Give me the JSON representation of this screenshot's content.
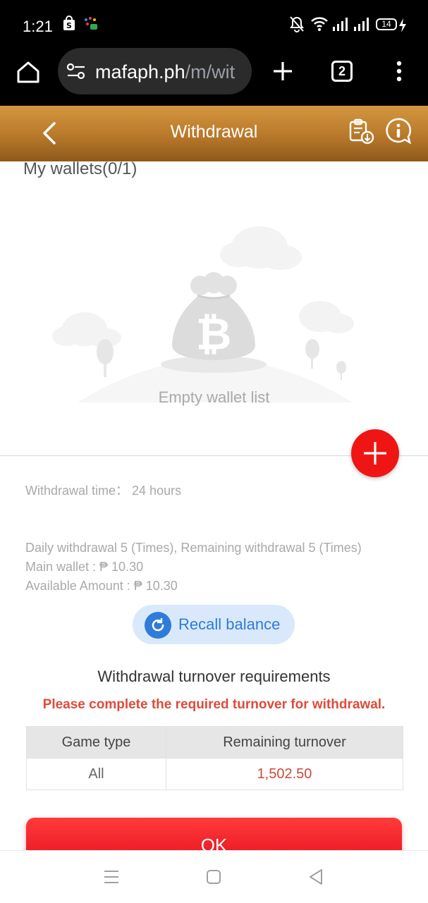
{
  "status_bar": {
    "time": "1:21",
    "battery": "14"
  },
  "browser": {
    "url_host": "mafaph.ph",
    "url_path": "/m/wit",
    "tab_count": "2"
  },
  "header": {
    "title": "Withdrawal"
  },
  "wallets": {
    "title": "My wallets(0/1)",
    "empty_text": "Empty wallet list"
  },
  "info": {
    "withdrawal_time": "Withdrawal time： 24 hours",
    "daily_limit": "Daily withdrawal 5 (Times), Remaining withdrawal 5 (Times)",
    "main_wallet": "Main wallet : ₱ 10.30",
    "available_amount": "Available Amount : ₱ 10.30"
  },
  "recall_button": {
    "label": "Recall balance"
  },
  "turnover": {
    "title": "Withdrawal turnover requirements",
    "warning": "Please complete the required turnover for withdrawal.",
    "table": {
      "headers": [
        "Game type",
        "Remaining turnover"
      ],
      "rows": [
        {
          "game_type": "All",
          "remaining": "1,502.50"
        }
      ]
    }
  },
  "ok_button": {
    "label": "OK"
  },
  "colors": {
    "header_gold": "#c4873a",
    "accent_red": "#f01515",
    "warning_red": "#e04a3a",
    "recall_blue": "#2f7bd9"
  }
}
